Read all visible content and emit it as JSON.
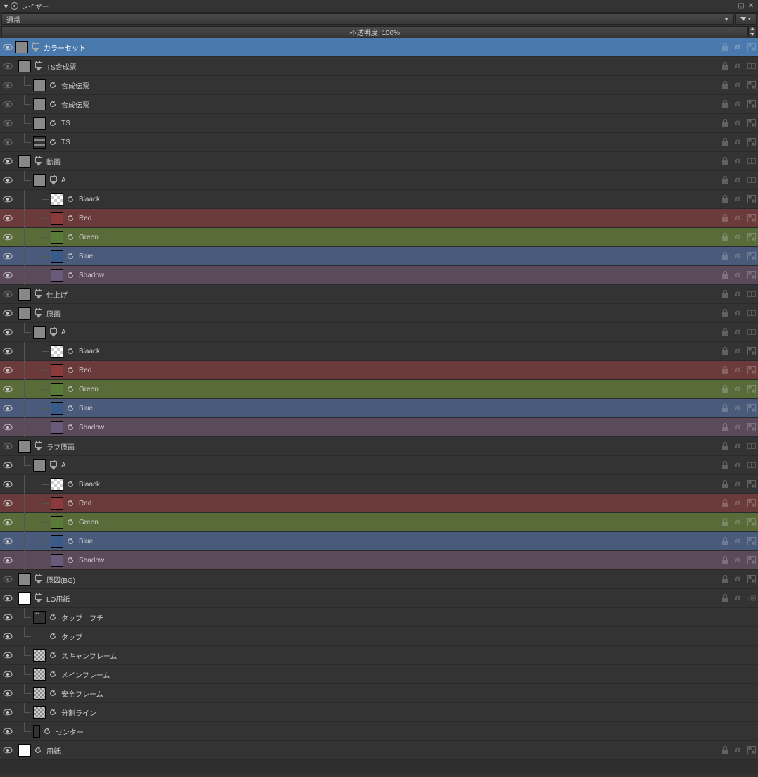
{
  "panel": {
    "title": "レイヤー"
  },
  "mode": {
    "label": "通常"
  },
  "opacity": {
    "label": "不透明度: 100%"
  },
  "layers": [
    {
      "name": "カラーセット",
      "depth": 0,
      "thumb": "blank",
      "sel": true,
      "folder": true,
      "flags": [
        "lock",
        "alpha",
        "x"
      ]
    },
    {
      "name": "TS合成票",
      "depth": 0,
      "thumb": "blank",
      "folder": true,
      "eye_dim": true,
      "flags": [
        "lock",
        "alpha",
        "xx"
      ]
    },
    {
      "name": "合成伝票",
      "depth": 1,
      "thumb": "blank",
      "refresh": true,
      "eye_dim": true,
      "flags": [
        "lock",
        "alpha",
        "x"
      ]
    },
    {
      "name": "合成伝票",
      "depth": 1,
      "thumb": "blank",
      "refresh": true,
      "eye_dim": true,
      "flags": [
        "lock",
        "alpha",
        "x"
      ]
    },
    {
      "name": "TS",
      "depth": 1,
      "thumb": "blank",
      "refresh": true,
      "eye_dim": true,
      "flags": [
        "lock",
        "alpha",
        "x"
      ]
    },
    {
      "name": "TS",
      "depth": 1,
      "thumb": "stripe",
      "refresh": true,
      "eye_dim": true,
      "flags": [
        "lock",
        "alpha",
        "x"
      ]
    },
    {
      "name": "動画",
      "depth": 0,
      "thumb": "blank",
      "folder": true,
      "flags": [
        "lock",
        "alpha",
        "xx"
      ]
    },
    {
      "name": "A",
      "depth": 1,
      "thumb": "blank",
      "folder": true,
      "flags": [
        "lock",
        "alpha",
        "xx"
      ]
    },
    {
      "name": "Blaack",
      "depth": 2,
      "thumb": "chk",
      "refresh": true,
      "flags": [
        "lock",
        "alpha",
        "x"
      ]
    },
    {
      "name": "Red",
      "depth": 2,
      "thumb": "redt",
      "refresh": true,
      "color": "red",
      "flags": [
        "lock",
        "alpha",
        "x"
      ]
    },
    {
      "name": "Green",
      "depth": 2,
      "thumb": "greent",
      "refresh": true,
      "color": "green",
      "flags": [
        "lock",
        "alpha",
        "x"
      ]
    },
    {
      "name": "Blue",
      "depth": 2,
      "thumb": "bluet",
      "refresh": true,
      "color": "blue",
      "flags": [
        "lock",
        "alpha",
        "x"
      ]
    },
    {
      "name": "Shadow",
      "depth": 2,
      "thumb": "shadowt",
      "refresh": true,
      "color": "shadow",
      "flags": [
        "lock",
        "alpha",
        "x"
      ]
    },
    {
      "name": "仕上げ",
      "depth": 0,
      "thumb": "blank",
      "folder": true,
      "eye_dim": true,
      "flags": [
        "lock",
        "alpha",
        "xx"
      ]
    },
    {
      "name": "原画",
      "depth": 0,
      "thumb": "blank",
      "folder": true,
      "flags": [
        "lock",
        "alpha",
        "xx"
      ]
    },
    {
      "name": "A",
      "depth": 1,
      "thumb": "blank",
      "folder": true,
      "flags": [
        "lock",
        "alpha",
        "xx"
      ]
    },
    {
      "name": "Blaack",
      "depth": 2,
      "thumb": "chk",
      "refresh": true,
      "flags": [
        "lock",
        "alpha",
        "x"
      ]
    },
    {
      "name": "Red",
      "depth": 2,
      "thumb": "redt",
      "refresh": true,
      "color": "red",
      "flags": [
        "lock",
        "alpha",
        "x"
      ]
    },
    {
      "name": "Green",
      "depth": 2,
      "thumb": "greent",
      "refresh": true,
      "color": "green",
      "flags": [
        "lock",
        "alpha",
        "x"
      ]
    },
    {
      "name": "Blue",
      "depth": 2,
      "thumb": "bluet",
      "refresh": true,
      "color": "blue",
      "flags": [
        "lock",
        "alpha",
        "x"
      ]
    },
    {
      "name": "Shadow",
      "depth": 2,
      "thumb": "shadowt",
      "refresh": true,
      "color": "shadow",
      "flags": [
        "lock",
        "alpha",
        "x"
      ]
    },
    {
      "name": "ラフ原画",
      "depth": 0,
      "thumb": "blank",
      "folder": true,
      "eye_dim": true,
      "flags": [
        "lock",
        "alpha",
        "xx"
      ]
    },
    {
      "name": "A",
      "depth": 1,
      "thumb": "blank",
      "folder": true,
      "flags": [
        "lock",
        "alpha",
        "xx"
      ]
    },
    {
      "name": "Blaack",
      "depth": 2,
      "thumb": "chk",
      "refresh": true,
      "flags": [
        "lock",
        "alpha",
        "x"
      ]
    },
    {
      "name": "Red",
      "depth": 2,
      "thumb": "redt",
      "refresh": true,
      "color": "red",
      "flags": [
        "lock",
        "alpha",
        "x"
      ]
    },
    {
      "name": "Green",
      "depth": 2,
      "thumb": "greent",
      "refresh": true,
      "color": "green",
      "flags": [
        "lock",
        "alpha",
        "x"
      ]
    },
    {
      "name": "Blue",
      "depth": 2,
      "thumb": "bluet",
      "refresh": true,
      "color": "blue",
      "flags": [
        "lock",
        "alpha",
        "x"
      ]
    },
    {
      "name": "Shadow",
      "depth": 2,
      "thumb": "shadowt",
      "refresh": true,
      "color": "shadow",
      "flags": [
        "lock",
        "alpha",
        "x"
      ]
    },
    {
      "name": "原図(BG)",
      "depth": 0,
      "thumb": "blank",
      "folder": true,
      "eye_dim": true,
      "flags": [
        "lock",
        "alpha",
        "x"
      ]
    },
    {
      "name": "LO用紙",
      "depth": 0,
      "thumb": "white",
      "folder": true,
      "flags": [
        "lock",
        "alpha",
        "xh"
      ]
    },
    {
      "name": "タップ＿フチ",
      "depth": 1,
      "thumb": "dots",
      "refresh": true,
      "flags": []
    },
    {
      "name": "タップ",
      "depth": 1,
      "thumb": "none",
      "refresh": true,
      "flags": []
    },
    {
      "name": "スキャンフレーム",
      "depth": 1,
      "thumb": "chk2",
      "refresh": true,
      "flags": []
    },
    {
      "name": "メインフレーム",
      "depth": 1,
      "thumb": "chk2",
      "refresh": true,
      "flags": []
    },
    {
      "name": "安全フレーム",
      "depth": 1,
      "thumb": "chk2",
      "refresh": true,
      "flags": []
    },
    {
      "name": "分割ライン",
      "depth": 1,
      "thumb": "chk2",
      "refresh": true,
      "flags": []
    },
    {
      "name": "センター",
      "depth": 1,
      "thumb": "tall",
      "refresh": true,
      "flags": []
    },
    {
      "name": "用紙",
      "depth": 0,
      "thumb": "white",
      "refresh": true,
      "flags": [
        "lock",
        "alpha",
        "x"
      ]
    }
  ]
}
